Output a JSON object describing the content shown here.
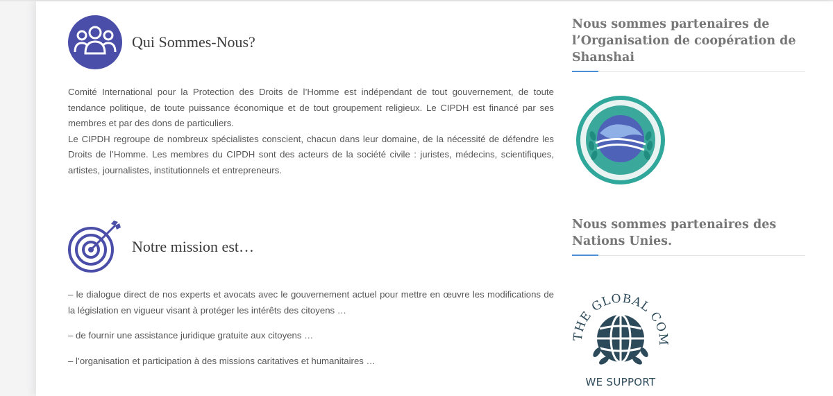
{
  "about": {
    "title": "Qui Sommes-Nous?",
    "icon": "people-group-icon",
    "paragraphs": [
      "Comité International pour la Protection des Droits de l’Homme est indépendant de tout gouvernement, de toute tendance politique, de toute puissance économique et de tout groupement religieux. Le CIPDH est financé par ses membres et par des dons de particuliers.",
      "Le CIPDH regroupe de nombreux spécialistes conscient, chacun dans leur domaine, de la nécessité de défendre les Droits de l’Homme. Les membres du CIPDH sont des acteurs de la société civile : juristes, médecins, scientifiques, artistes, journalistes, institutionnels et entrepreneurs."
    ]
  },
  "mission": {
    "title": "Notre mission est…",
    "icon": "target-arrow-icon",
    "items": [
      "– le dialogue direct de nos experts et avocats avec le gouvernement actuel pour mettre en œuvre les modifications de la législation en vigueur visant à protéger les intérêts des citoyens …",
      "– de fournir une assistance juridique gratuite aux citoyens …",
      "– l’organisation et participation à des missions caritatives et humanitaires …"
    ]
  },
  "sidebar": {
    "widget1": {
      "title": "Nous sommes partenaires de l’Organisation de coopération de Shanshai",
      "logo": "sco-emblem-icon"
    },
    "widget2": {
      "title": "Nous sommes partenaires des Nations Unies.",
      "logo": "global-compact-icon",
      "logo_text": "THE GLOBAL COMPACT",
      "logo_caption": "WE SUPPORT"
    }
  },
  "colors": {
    "accent": "#4a4ea8",
    "rule_accent": "#4a8fd6",
    "sco_teal": "#2fa79b",
    "gc_dark": "#2d4a5a"
  }
}
